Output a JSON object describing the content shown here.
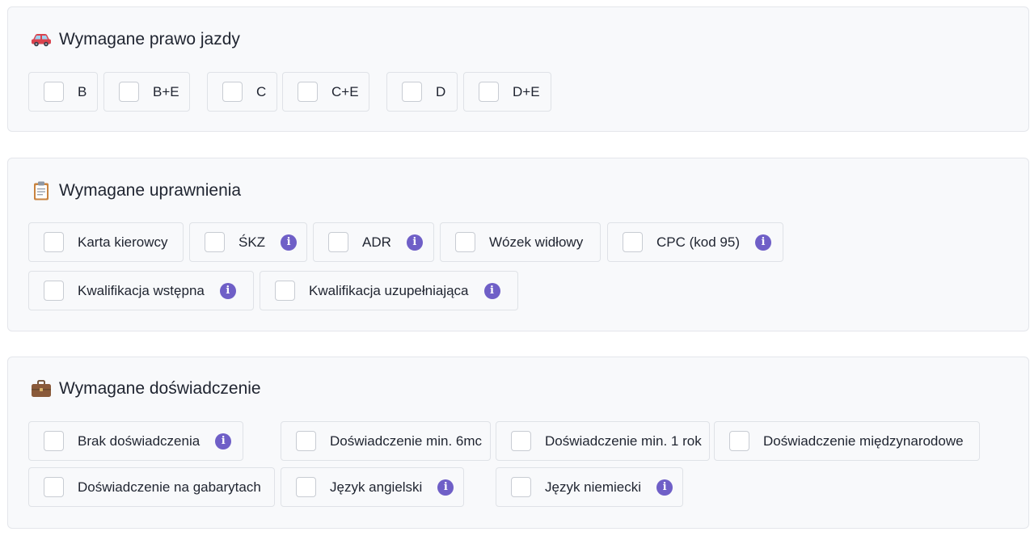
{
  "license": {
    "title": "Wymagane prawo jazdy",
    "icon": "car-icon",
    "options": [
      {
        "label": "B"
      },
      {
        "label": "B+E"
      },
      {
        "label": "C"
      },
      {
        "label": "C+E"
      },
      {
        "label": "D"
      },
      {
        "label": "D+E"
      }
    ]
  },
  "permissions": {
    "title": "Wymagane uprawnienia",
    "icon": "clipboard-icon",
    "options": [
      {
        "label": "Karta kierowcy",
        "info": false
      },
      {
        "label": "ŚKZ",
        "info": true
      },
      {
        "label": "ADR",
        "info": true
      },
      {
        "label": "Wózek widłowy",
        "info": false
      },
      {
        "label": "CPC (kod 95)",
        "info": true
      },
      {
        "label": "Kwalifikacja wstępna",
        "info": true
      },
      {
        "label": "Kwalifikacja uzupełniająca",
        "info": true
      }
    ]
  },
  "experience": {
    "title": "Wymagane doświadczenie",
    "icon": "briefcase-icon",
    "options": [
      {
        "label": "Brak doświadczenia",
        "info": true
      },
      {
        "label": "Doświadczenie min. 6mc",
        "info": false
      },
      {
        "label": "Doświadczenie min. 1 rok",
        "info": false
      },
      {
        "label": "Doświadczenie międzynarodowe",
        "info": false
      },
      {
        "label": "Doświadczenie na gabarytach",
        "info": false
      },
      {
        "label": "Język angielski",
        "info": true
      },
      {
        "label": "Język niemiecki",
        "info": true
      }
    ]
  },
  "colors": {
    "info_badge": "#6f5fc7",
    "section_bg": "#f8f9fb",
    "border": "#dfe2e7"
  },
  "info_glyph": "i"
}
